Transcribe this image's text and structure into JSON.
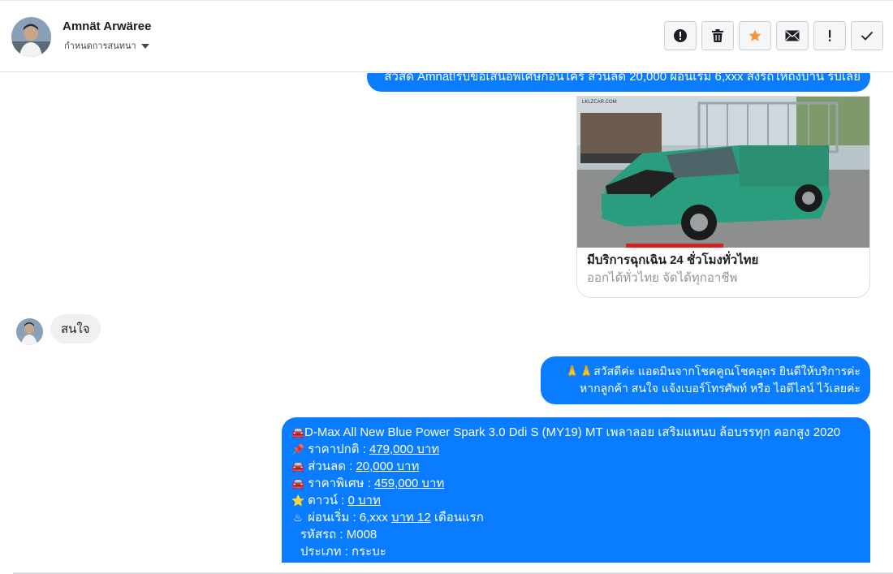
{
  "header": {
    "name": "Amnät Arwäree",
    "assign_label": "กำหนดการสนทนา",
    "actions": [
      {
        "icon": "alert-icon"
      },
      {
        "icon": "trash-icon"
      },
      {
        "icon": "star-icon"
      },
      {
        "icon": "envelope-icon"
      },
      {
        "icon": "exclamation-icon"
      },
      {
        "icon": "check-icon"
      }
    ],
    "accent_star": "#f7923a"
  },
  "messages": {
    "first": "สวัสดี Amnät!รับข้อเสนอพิเศษก่อนใคร ส่วนลด 20,000 ผ่อนเริ่ม 6,xxx ส่งรถให้ถึงบ้าน รับเลย",
    "card": {
      "image_watermark": "LKLZCAR.COM",
      "title": "มีบริการฉุกเฉิน 24 ชั่วโมงทั่วไทย",
      "subtitle": "ออกได้ทั่วไทย จัดได้ทุกอาชีพ"
    },
    "incoming": "สนใจ",
    "reply": {
      "line1": "🙏🙏สวัสดีค่ะ แอดมินจากโชคคูณโชคอุดร ยินดีให้บริการค่ะ",
      "line2": "หากลูกค้า สนใจ แจ้งเบอร์โทรศัพท์ หรือ ไอดีไลน์  ไว้เลยค่ะ"
    },
    "offer": {
      "title": "D-Max All New Blue Power Spark 3.0 Ddi S (MY19) MT เพลาลอย เสริมแหนบ ล้อบรรทุก คอกสูง 2020",
      "price_label": "ราคาปกติ : ",
      "price_value": "479,000 บาท",
      "discount_label": "ส่วนลด : ",
      "discount_value": "20,000 บาท",
      "special_label": "ราคาพิเศษ : ",
      "special_value": "459,000 บาท",
      "down_label": "ดาวน์ : ",
      "down_value": "0 บาท",
      "installment_label": "ผ่อนเริ่ม : 6,xxx ",
      "installment_value": "บาท 12",
      "installment_suffix": " เดือนแรก",
      "code_line": "รหัสรถ : M008",
      "type_line": "ประเภท : กระบะ"
    },
    "bubble_out_color": "#0a7cff"
  }
}
